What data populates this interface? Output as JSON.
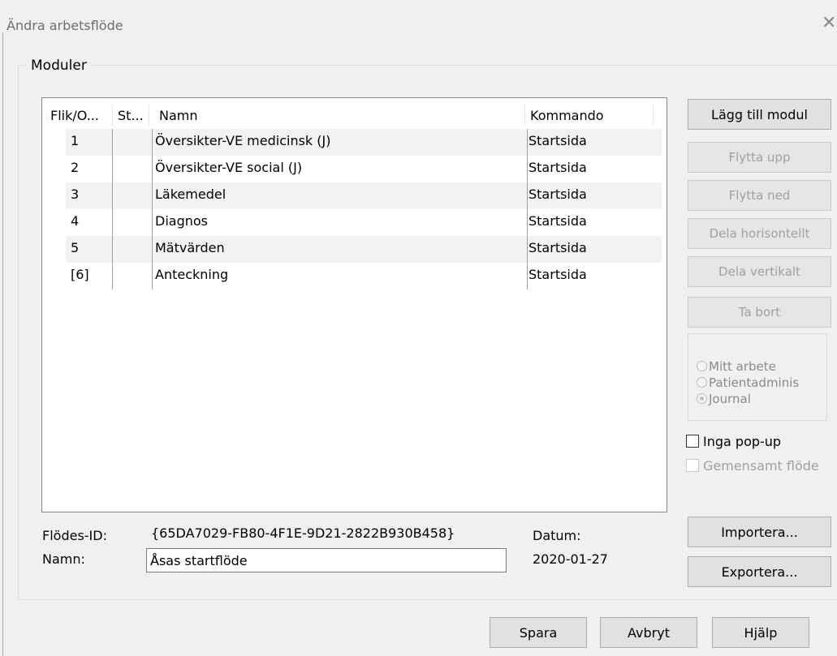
{
  "window": {
    "title": "Ändra arbetsflöde",
    "close_glyph": "✕"
  },
  "group": {
    "label": "Moduler"
  },
  "table": {
    "columns": [
      "Flik/O...",
      "St...",
      "Namn",
      "Kommando"
    ],
    "rows": [
      {
        "tab": "1",
        "status": "",
        "name": "Översikter-VE medicinsk (J)",
        "command": "Startsida"
      },
      {
        "tab": "2",
        "status": "",
        "name": "Översikter-VE social (J)",
        "command": "Startsida"
      },
      {
        "tab": "3",
        "status": "",
        "name": "Läkemedel",
        "command": "Startsida"
      },
      {
        "tab": "4",
        "status": "",
        "name": "Diagnos",
        "command": "Startsida"
      },
      {
        "tab": "5",
        "status": "",
        "name": "Mätvärden",
        "command": "Startsida"
      },
      {
        "tab": "[6]",
        "status": "",
        "name": "Anteckning",
        "command": "Startsida"
      }
    ]
  },
  "side_buttons": {
    "add": "Lägg till modul",
    "move_up": "Flytta upp",
    "move_down": "Flytta ned",
    "split_h": "Dela horisontellt",
    "split_v": "Dela vertikalt",
    "remove": "Ta bort"
  },
  "radios": {
    "options": [
      "Mitt arbete",
      "Patientadminis",
      "Journal"
    ],
    "selected": "Journal"
  },
  "checkboxes": {
    "no_popup": {
      "label": "Inga pop-up",
      "checked": false,
      "enabled": true
    },
    "shared": {
      "label": "Gemensamt flöde",
      "checked": false,
      "enabled": false
    }
  },
  "fields": {
    "flow_id_label": "Flödes-ID:",
    "flow_id_value": "{65DA7029-FB80-4F1E-9D21-2822B930B458}",
    "name_label": "Namn:",
    "name_value": "Åsas startflöde",
    "date_label": "Datum:",
    "date_value": "2020-01-27"
  },
  "io_buttons": {
    "import": "Importera...",
    "export": "Exportera..."
  },
  "footer": {
    "save": "Spara",
    "cancel": "Avbryt",
    "help": "Hjälp"
  }
}
